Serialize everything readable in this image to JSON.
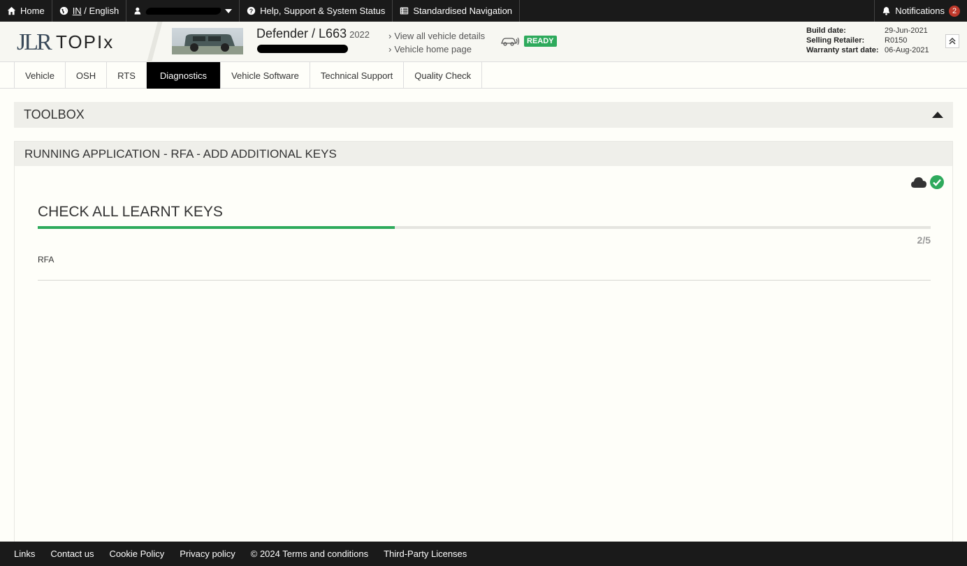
{
  "topbar": {
    "home": "Home",
    "region": "IN",
    "language_sep": " / ",
    "language": "English",
    "help": "Help, Support & System Status",
    "navigation": "Standardised Navigation",
    "notifications": "Notifications",
    "notification_count": "2"
  },
  "header": {
    "logo_left": "JLR",
    "logo_right": "TOPIx",
    "vehicle_title": "Defender / L663",
    "vehicle_year": "2022",
    "links": [
      "View all vehicle details",
      "Vehicle home page"
    ],
    "status": "READY",
    "meta": [
      {
        "label": "Build date:",
        "value": "29-Jun-2021"
      },
      {
        "label": "Selling Retailer:",
        "value": "R0150"
      },
      {
        "label": "Warranty start date:",
        "value": "06-Aug-2021"
      }
    ]
  },
  "tabs": [
    "Vehicle",
    "OSH",
    "RTS",
    "Diagnostics",
    "Vehicle Software",
    "Technical Support",
    "Quality Check"
  ],
  "active_tab": "Diagnostics",
  "toolbox": {
    "title": "TOOLBOX"
  },
  "running_app": {
    "title": "RUNNING APPLICATION - RFA - ADD ADDITIONAL KEYS",
    "step_title": "CHECK ALL LEARNT KEYS",
    "step_count": "2/5",
    "progress_fraction": 0.4,
    "app_label": "RFA"
  },
  "footer": [
    "Links",
    "Contact us",
    "Cookie Policy",
    "Privacy policy",
    "© 2024 Terms and conditions",
    "Third-Party Licenses"
  ],
  "colors": {
    "accent_green": "#2eaa5c",
    "topbar_bg": "#1a1a1a",
    "badge_red": "#c0392b"
  },
  "icons": [
    "home-icon",
    "globe-icon",
    "user-icon",
    "help-icon",
    "list-icon",
    "bell-icon",
    "cloud-icon",
    "check-circle-icon",
    "car-connection-icon",
    "double-chevron-up-icon"
  ]
}
